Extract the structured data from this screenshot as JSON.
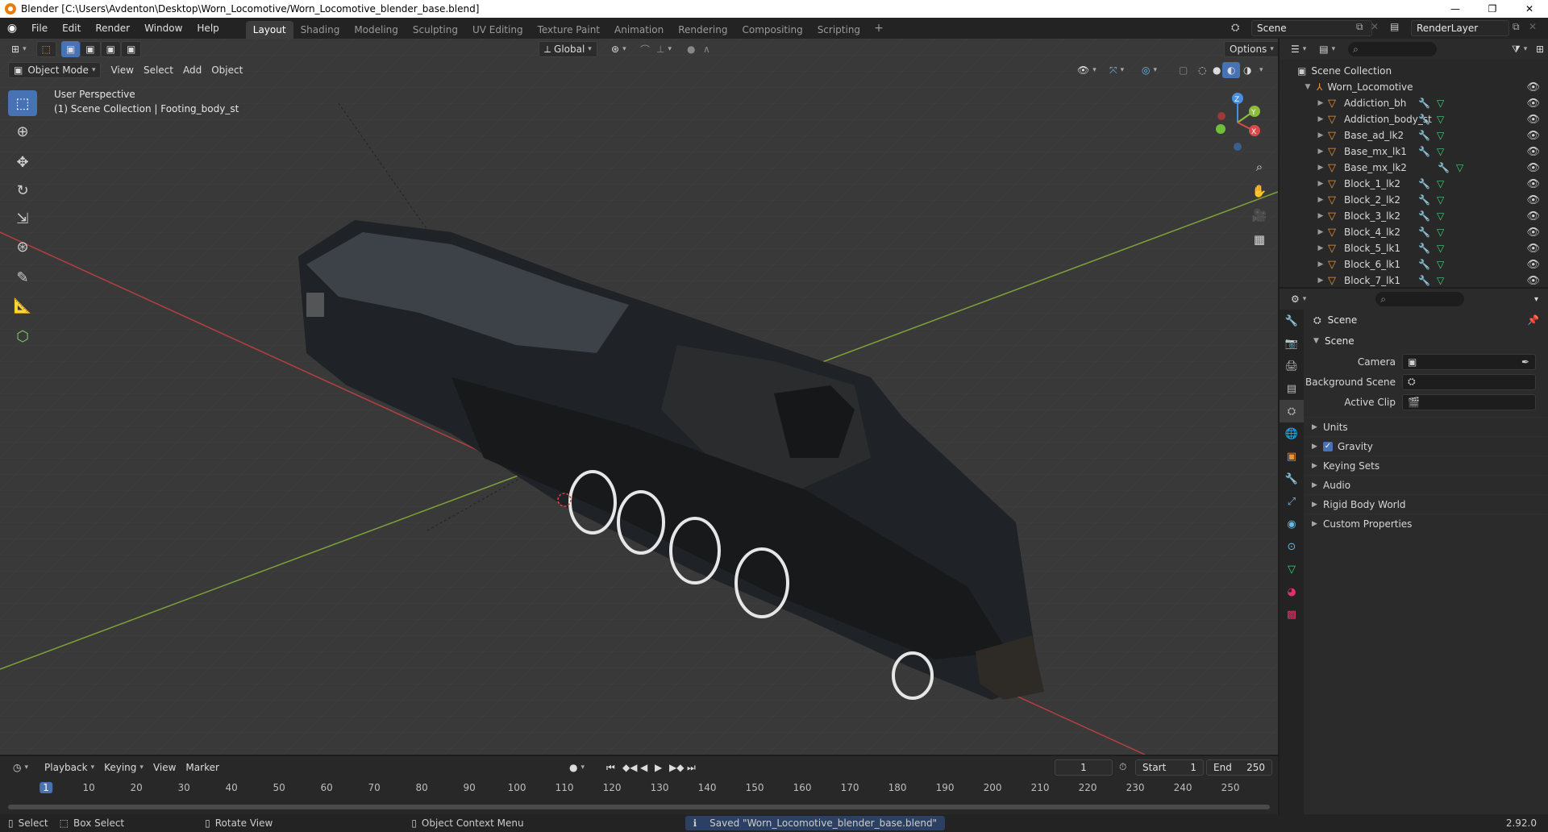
{
  "window": {
    "title": "Blender [C:\\Users\\Avdenton\\Desktop\\Worn_Locomotive/Worn_Locomotive_blender_base.blend]",
    "minimize": "—",
    "maximize": "❐",
    "close": "✕"
  },
  "menu": [
    "File",
    "Edit",
    "Render",
    "Window",
    "Help"
  ],
  "workspaces": [
    "Layout",
    "Shading",
    "Modeling",
    "Sculpting",
    "UV Editing",
    "Texture Paint",
    "Animation",
    "Rendering",
    "Compositing",
    "Scripting"
  ],
  "active_workspace": "Layout",
  "scene_name": "Scene",
  "view_layer": "RenderLayer",
  "viewport": {
    "transform_orientation": "Global",
    "options_label": "Options",
    "mode": "Object Mode",
    "header_menus": [
      "View",
      "Select",
      "Add",
      "Object"
    ],
    "perspective_label": "User Perspective",
    "context_label": "(1) Scene Collection | Footing_body_st",
    "gizmo_axes": {
      "x": "X",
      "y": "Y",
      "z": "Z"
    }
  },
  "timeline": {
    "menus": [
      "Playback",
      "Keying",
      "View",
      "Marker"
    ],
    "current_frame": "1",
    "start_label": "Start",
    "start_value": "1",
    "end_label": "End",
    "end_value": "250",
    "ruler": [
      "1",
      "10",
      "20",
      "30",
      "40",
      "50",
      "60",
      "70",
      "80",
      "90",
      "100",
      "110",
      "120",
      "130",
      "140",
      "150",
      "160",
      "170",
      "180",
      "190",
      "200",
      "210",
      "220",
      "230",
      "240",
      "250"
    ]
  },
  "statusbar": {
    "select": "Select",
    "box_select": "Box Select",
    "rotate_view": "Rotate View",
    "context_menu": "Object Context Menu",
    "saved_message": "Saved \"Worn_Locomotive_blender_base.blend\"",
    "version": "2.92.0"
  },
  "outliner": {
    "root": "Scene Collection",
    "collection": "Worn_Locomotive",
    "objects": [
      "Addiction_bh",
      "Addiction_body_st",
      "Base_ad_lk2",
      "Base_mx_lk1",
      "Base_mx_lk2",
      "Block_1_lk2",
      "Block_2_lk2",
      "Block_3_lk2",
      "Block_4_lk2",
      "Block_5_lk1",
      "Block_6_lk1",
      "Block_7_lk1"
    ],
    "has_modifier": [
      true,
      true,
      true,
      true,
      false,
      true,
      true,
      true,
      true,
      true,
      true,
      true
    ]
  },
  "properties": {
    "context": "Scene",
    "panel": "Scene",
    "fields": {
      "camera_label": "Camera",
      "background_scene_label": "Background Scene",
      "active_clip_label": "Active Clip"
    },
    "subpanels": {
      "units": "Units",
      "gravity": "Gravity",
      "keying_sets": "Keying Sets",
      "audio": "Audio",
      "rigid_body_world": "Rigid Body World",
      "custom_properties": "Custom Properties"
    },
    "gravity_enabled": true
  },
  "colors": {
    "accent": "#4772b3",
    "x_axis": "#d94a4a",
    "y_axis": "#8dbb3b",
    "z_axis": "#4a8ee0",
    "object_icon": "#e8923a"
  }
}
